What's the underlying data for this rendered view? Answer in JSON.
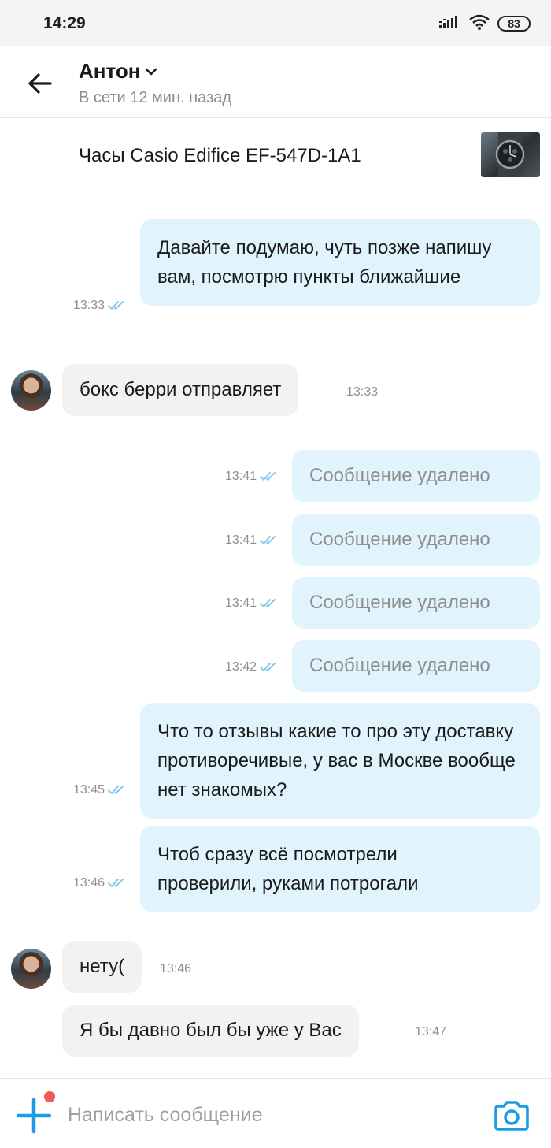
{
  "status_bar": {
    "time": "14:29",
    "battery": "83"
  },
  "header": {
    "contact_name": "Антон",
    "contact_status": "В сети 12 мин. назад"
  },
  "product": {
    "title": "Часы Casio Edifice EF-547D-1A1"
  },
  "messages": [
    {
      "dir": "out",
      "text": "Давайте подумаю, чуть позже напишу вам, посмотрю пункты ближайшие",
      "time": "13:33",
      "read": true
    },
    {
      "dir": "in",
      "text": "бокс берри отправляет",
      "time": "13:33"
    },
    {
      "dir": "out",
      "text": "Сообщение удалено",
      "time": "13:41",
      "read": true,
      "deleted": true
    },
    {
      "dir": "out",
      "text": "Сообщение удалено",
      "time": "13:41",
      "read": true,
      "deleted": true
    },
    {
      "dir": "out",
      "text": "Сообщение удалено",
      "time": "13:41",
      "read": true,
      "deleted": true
    },
    {
      "dir": "out",
      "text": "Сообщение удалено",
      "time": "13:42",
      "read": true,
      "deleted": true
    },
    {
      "dir": "out",
      "text": "Что то отзывы какие то про эту доставку противоречивые, у вас в Москве вообще нет знакомых?",
      "time": "13:45",
      "read": true
    },
    {
      "dir": "out",
      "text": "Чтоб сразу всё посмотрели проверили, руками потрогали",
      "time": "13:46",
      "read": true
    },
    {
      "dir": "in",
      "text": "нету(",
      "time": "13:46"
    },
    {
      "dir": "in",
      "text": "Я бы давно был бы уже у Вас",
      "time": "13:47"
    }
  ],
  "composer": {
    "placeholder": "Написать сообщение"
  },
  "colors": {
    "accent": "#1a9be6",
    "outgoing_bubble": "#e1f3fd",
    "incoming_bubble": "#f2f2f2",
    "read_check": "#7cc3ee",
    "notification_dot": "#f15a5a"
  },
  "icons": [
    "back-arrow-icon",
    "chevron-down-icon",
    "signal-icon",
    "wifi-icon",
    "battery-icon",
    "double-check-icon",
    "plus-icon",
    "camera-icon"
  ]
}
